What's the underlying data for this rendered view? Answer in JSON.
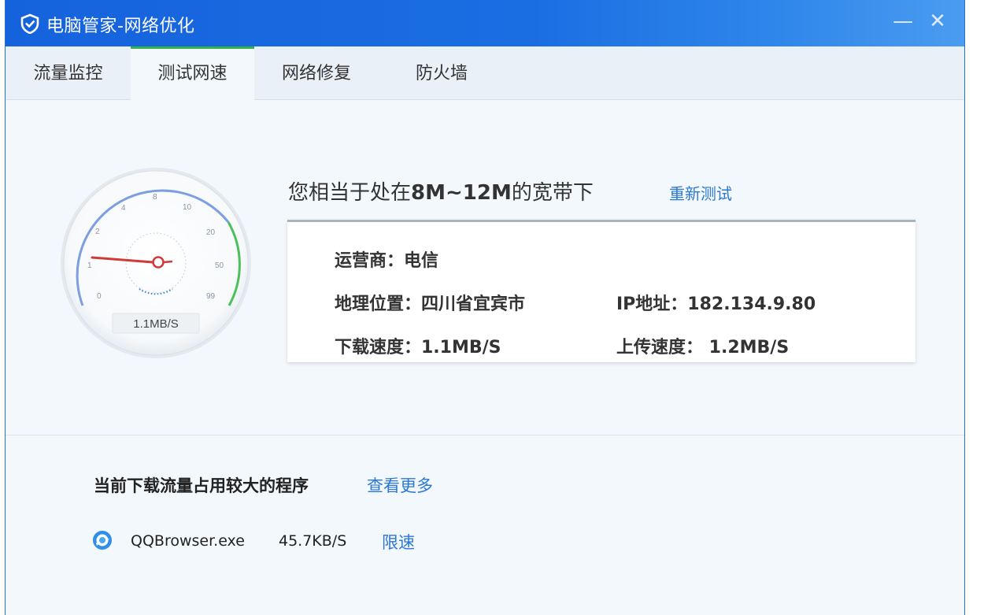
{
  "window": {
    "title": "电脑管家-网络优化",
    "minimize_glyph": "—",
    "close_glyph": "✕",
    "app_icon": "shield-check-icon"
  },
  "tabs": [
    {
      "label": "流量监控",
      "active": false
    },
    {
      "label": "测试网速",
      "active": true
    },
    {
      "label": "网络修复",
      "active": false
    },
    {
      "label": "防火墙",
      "active": false
    }
  ],
  "gauge": {
    "ticks": [
      "0",
      "1",
      "2",
      "4",
      "8",
      "10",
      "20",
      "50",
      "99"
    ],
    "readout": "1.1MB/S"
  },
  "result": {
    "prefix": "您相当于处在",
    "bandwidth": "8M~12M",
    "suffix": "的宽带下",
    "retest_label": "重新测试"
  },
  "info": {
    "isp": "运营商：电信",
    "location": "地理位置：四川省宜宾市",
    "ip": "IP地址：182.134.9.80",
    "download": "下载速度：1.1MB/S",
    "upload": "上传速度：  1.2MB/S"
  },
  "programs": {
    "title": "当前下载流量占用较大的程序",
    "more_label": "查看更多",
    "items": [
      {
        "icon": "qqbrowser-icon",
        "name": "QQBrowser.exe",
        "speed": "45.7KB/S",
        "action": "限速"
      }
    ]
  },
  "colors": {
    "titlebar": "#1562dd",
    "active_tab_indicator": "#35b34a",
    "link": "#2b78d4",
    "needle": "#d03a3a"
  }
}
